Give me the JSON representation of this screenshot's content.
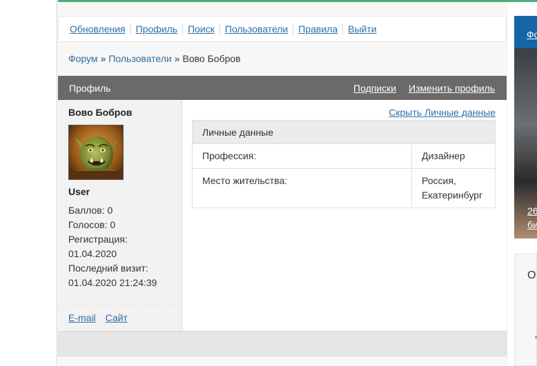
{
  "menu": {
    "items": [
      "Обновления",
      "Профиль",
      "Поиск",
      "Пользователи",
      "Правила",
      "Выйти"
    ]
  },
  "breadcrumb": {
    "forum": "Форум",
    "users": "Пользователи",
    "current": "Вово Бобров",
    "separator": "»"
  },
  "profile_header": {
    "title": "Профиль",
    "subscriptions": "Подписки",
    "edit_profile": "Изменить профиль"
  },
  "user": {
    "name": "Вово Бобров",
    "role": "User",
    "stats": {
      "points": "Баллов: 0",
      "votes": "Голосов: 0",
      "registration_label": "Регистрация:",
      "registration_date": "01.04.2020",
      "last_visit_label": "Последний визит:",
      "last_visit_date": "01.04.2020 21:24:39"
    },
    "contacts": {
      "email": "E-mail",
      "site": "Сайт"
    }
  },
  "personal": {
    "hide_link": "Скрыть Личные данные",
    "heading": "Личные данные",
    "rows": [
      {
        "label": "Профессия:",
        "value": "Дизайнер"
      },
      {
        "label": "Место жительства:",
        "value": "Россия, Екатеринбург"
      }
    ]
  },
  "right_banner": {
    "top_text": "Фо",
    "caption_1": "26",
    "caption_2": "би"
  },
  "right_box": {
    "text": "О"
  },
  "colors": {
    "link": "#2e6da4",
    "header_bg": "#6a6a6a",
    "accent_green": "#4caf79",
    "banner_blue": "#1565a8"
  },
  "icons": {
    "avatar": "orc-avatar-image"
  }
}
